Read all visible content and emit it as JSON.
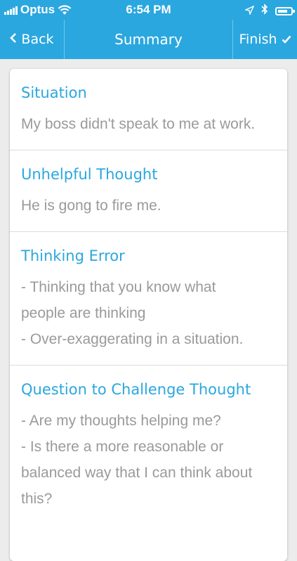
{
  "status_bar": {
    "carrier": "Optus",
    "time": "6:54 PM"
  },
  "nav": {
    "back_label": "Back",
    "title": "Summary",
    "finish_label": "Finish"
  },
  "sections": [
    {
      "title": "Situation",
      "lines": [
        "My boss didn't speak to me at work."
      ]
    },
    {
      "title": "Unhelpful Thought",
      "lines": [
        "He is gong to fire me."
      ]
    },
    {
      "title": "Thinking Error",
      "lines": [
        "- Thinking that you know what",
        "people are thinking",
        "- Over-exaggerating in a situation."
      ]
    },
    {
      "title": "Question to Challenge Thought",
      "lines": [
        "- Are my thoughts helping me?",
        "- Is there a more reasonable or",
        "balanced way that I can think about",
        "this?"
      ]
    }
  ],
  "colors": {
    "accent": "#2aa7df",
    "body_text": "#9a9a9a"
  },
  "icons": {
    "signal": "signal-bars-icon",
    "wifi": "wifi-icon",
    "location": "location-arrow-icon",
    "bluetooth": "bluetooth-icon",
    "battery": "battery-icon",
    "back": "chevron-left-icon",
    "finish": "checkmark-icon"
  }
}
